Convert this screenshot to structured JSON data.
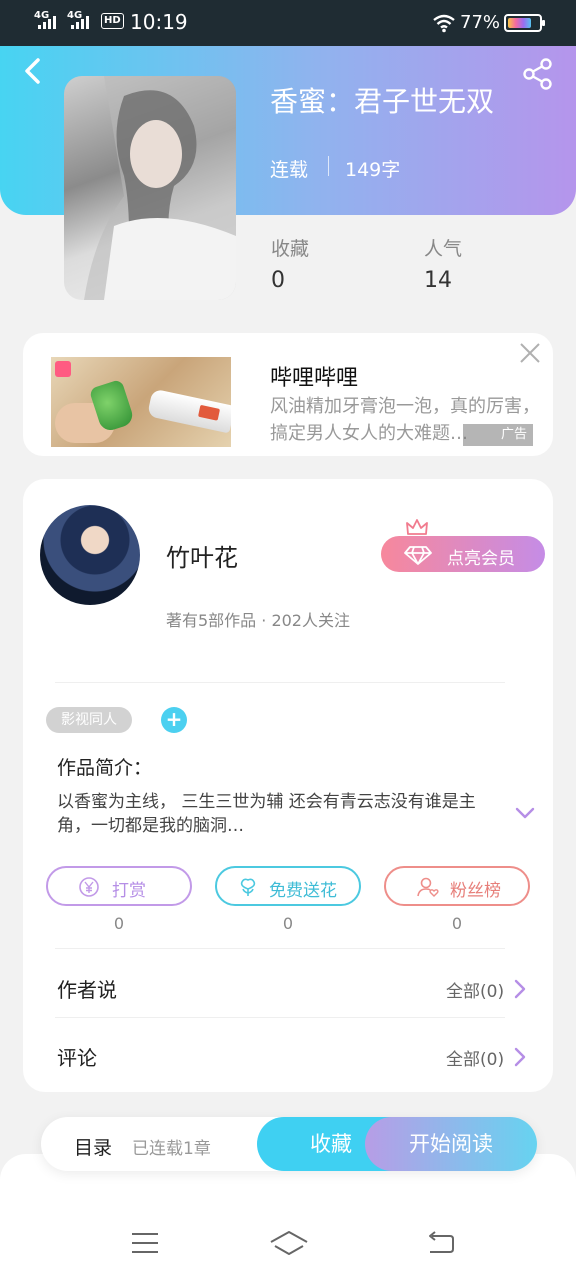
{
  "status_bar": {
    "signal1": "4G",
    "signal2": "4G",
    "hd": "HD",
    "time": "10:19",
    "battery": "77%"
  },
  "book": {
    "title": "香蜜：君子世无双",
    "status": "连载",
    "word_count": "149字",
    "stats": [
      {
        "label": "收藏",
        "value": "0"
      },
      {
        "label": "人气",
        "value": "14"
      }
    ]
  },
  "ad": {
    "title": "哔哩哔哩",
    "description": "风油精加牙膏泡一泡，真的厉害，搞定男人女人的大难题…",
    "tag": "广告"
  },
  "author": {
    "name": "竹叶花",
    "meta": "著有5部作品 · 202人关注",
    "vip_button": "点亮会员"
  },
  "work": {
    "tag": "影视同人",
    "intro_label": "作品简介：",
    "intro_text": "以香蜜为主线， 三生三世为辅 还会有青云志没有谁是主角，一切都是我的脑洞…"
  },
  "actions": [
    {
      "label": "打赏",
      "count": "0",
      "color": "#c29ae8"
    },
    {
      "label": "免费送花",
      "count": "0",
      "color": "#4cc9e0"
    },
    {
      "label": "粉丝榜",
      "count": "0",
      "color": "#ee8e8a"
    }
  ],
  "rows": [
    {
      "label": "作者说",
      "right": "全部(0)"
    },
    {
      "label": "评论",
      "right": "全部(0)"
    }
  ],
  "bottom_bar": {
    "toc_label": "目录",
    "toc_status": "已连载1章",
    "favorite": "收藏",
    "start_reading": "开始阅读"
  },
  "colors": {
    "accent_purple": "#b58ee6",
    "accent_cyan": "#3fd0f2"
  }
}
